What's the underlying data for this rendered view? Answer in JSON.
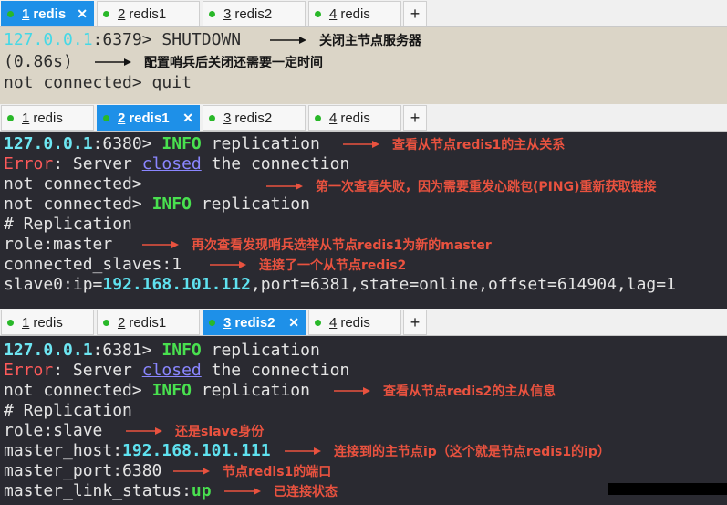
{
  "panels": [
    {
      "tabs": [
        {
          "num": "1",
          "name": "redis",
          "active": true
        },
        {
          "num": "2",
          "name": "redis1",
          "active": false
        },
        {
          "num": "3",
          "name": "redis2",
          "active": false
        },
        {
          "num": "4",
          "name": "redis",
          "active": false
        }
      ],
      "lines": {
        "l1": {
          "ip": "127.0.0.1",
          "port": ":6379>",
          "cmd": " SHUTDOWN"
        },
        "l2": {
          "text": "(0.86s)"
        },
        "l3": {
          "text": "not connected> quit"
        }
      },
      "annotations": {
        "a1": "关闭主节点服务器",
        "a2": "配置哨兵后关闭还需要一定时间"
      }
    },
    {
      "tabs": [
        {
          "num": "1",
          "name": "redis",
          "active": false
        },
        {
          "num": "2",
          "name": "redis1",
          "active": true
        },
        {
          "num": "3",
          "name": "redis2",
          "active": false
        },
        {
          "num": "4",
          "name": "redis",
          "active": false
        }
      ],
      "lines": {
        "l1": {
          "ip": "127.0.0.1",
          "port": ":6380>",
          "kw": "INFO",
          "rest": " replication"
        },
        "l2": {
          "error": "Error",
          "a": ": Server ",
          "closed": "closed",
          "b": " the connection"
        },
        "l3": {
          "text": "not connected>"
        },
        "l4": {
          "prompt": "not connected>",
          "kw": "INFO",
          "rest": " replication"
        },
        "l5": {
          "text": "# Replication"
        },
        "l6": {
          "text": "role:master"
        },
        "l7": {
          "text": "connected_slaves:1"
        },
        "l8": {
          "a": "slave0:ip=",
          "ip": "192.168.101.112",
          "b": ",port=6381,state=online,offset=614904,lag=1"
        }
      },
      "annotations": {
        "a1": "查看从节点redis1的主从关系",
        "a2": "第一次查看失败，因为需要重发心跳包(PING)重新获取链接",
        "a3": "再次查看发现哨兵选举从节点redis1为新的master",
        "a4": "连接了一个从节点redis2"
      }
    },
    {
      "tabs": [
        {
          "num": "1",
          "name": "redis",
          "active": false
        },
        {
          "num": "2",
          "name": "redis1",
          "active": false
        },
        {
          "num": "3",
          "name": "redis2",
          "active": true
        },
        {
          "num": "4",
          "name": "redis",
          "active": false
        }
      ],
      "lines": {
        "l1": {
          "ip": "127.0.0.1",
          "port": ":6381>",
          "kw": "INFO",
          "rest": " replication"
        },
        "l2": {
          "error": "Error",
          "a": ": Server ",
          "closed": "closed",
          "b": " the connection"
        },
        "l3": {
          "prompt": "not connected>",
          "kw": "INFO",
          "rest": " replication"
        },
        "l4": {
          "text": "# Replication"
        },
        "l5": {
          "text": "role:slave"
        },
        "l6": {
          "a": "master_host:",
          "ip": "192.168.101.111"
        },
        "l7": {
          "text": "master_port:6380"
        },
        "l8": {
          "a": "master_link_status:",
          "up": "up"
        }
      },
      "annotations": {
        "a1": "查看从节点redis2的主从信息",
        "a2": "还是slave身份",
        "a3": "连接到的主节点ip（这个就是节点redis1的ip）",
        "a4": "节点redis1的端口",
        "a5": "已连接状态"
      }
    }
  ],
  "add_tab_label": "+",
  "tab_close_label": "✕",
  "colors": {
    "tab_active": "#1e90e8",
    "status_dot": "#29b829",
    "terminal_dark": "#2a2a31",
    "terminal_light": "#dbd5c7",
    "annotation_red": "#e9523f",
    "ip_cyan": "#45d8e6",
    "keyword_green": "#49e04f",
    "error_red": "#ff5a5a",
    "closed_link": "#8a86ff"
  }
}
